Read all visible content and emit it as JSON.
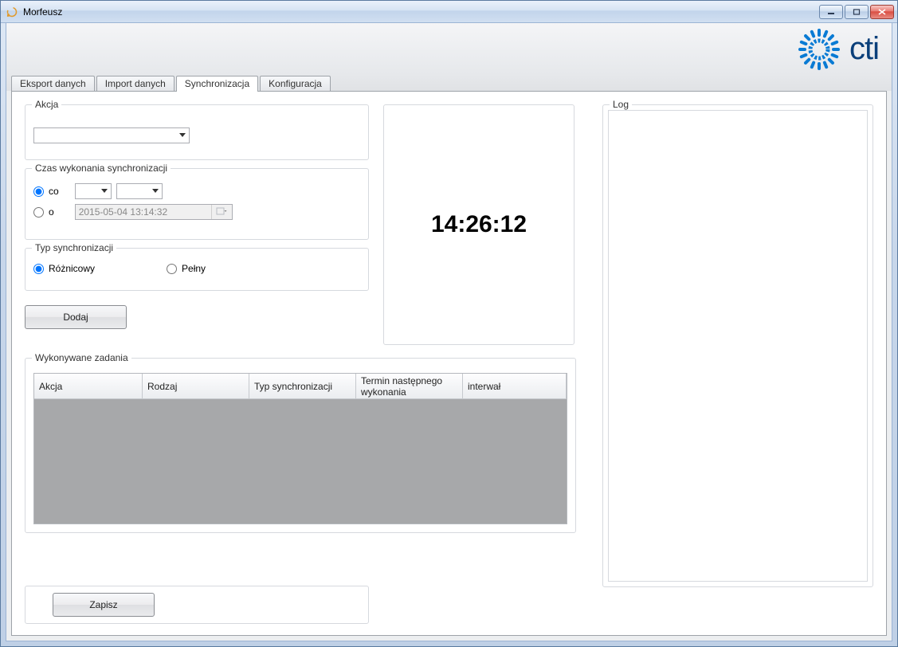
{
  "window": {
    "title": "Morfeusz"
  },
  "tabs": {
    "export": "Eksport danych",
    "import": "Import danych",
    "sync": "Synchronizacja",
    "config": "Konfiguracja",
    "active": "sync"
  },
  "sync": {
    "action": {
      "legend": "Akcja"
    },
    "interval": {
      "legend": "Czas wykonania synchronizacji",
      "opt_every_label": "co",
      "opt_at_label": "o",
      "selected": "every",
      "datetime_value": "2015-05-04 13:14:32"
    },
    "type": {
      "legend": "Typ synchronizacji",
      "diff_label": "Różnicowy",
      "full_label": "Pełny",
      "selected": "diff"
    },
    "add_button": "Dodaj",
    "save_button": "Zapisz"
  },
  "clock": {
    "time": "14:26:12"
  },
  "tasks": {
    "legend": "Wykonywane zadania",
    "columns": {
      "action": "Akcja",
      "kind": "Rodzaj",
      "sync_type": "Typ synchronizacji",
      "next_run": "Termin następnego wykonania",
      "interval": "interwał"
    }
  },
  "log": {
    "legend": "Log"
  },
  "logo_text": "cti"
}
